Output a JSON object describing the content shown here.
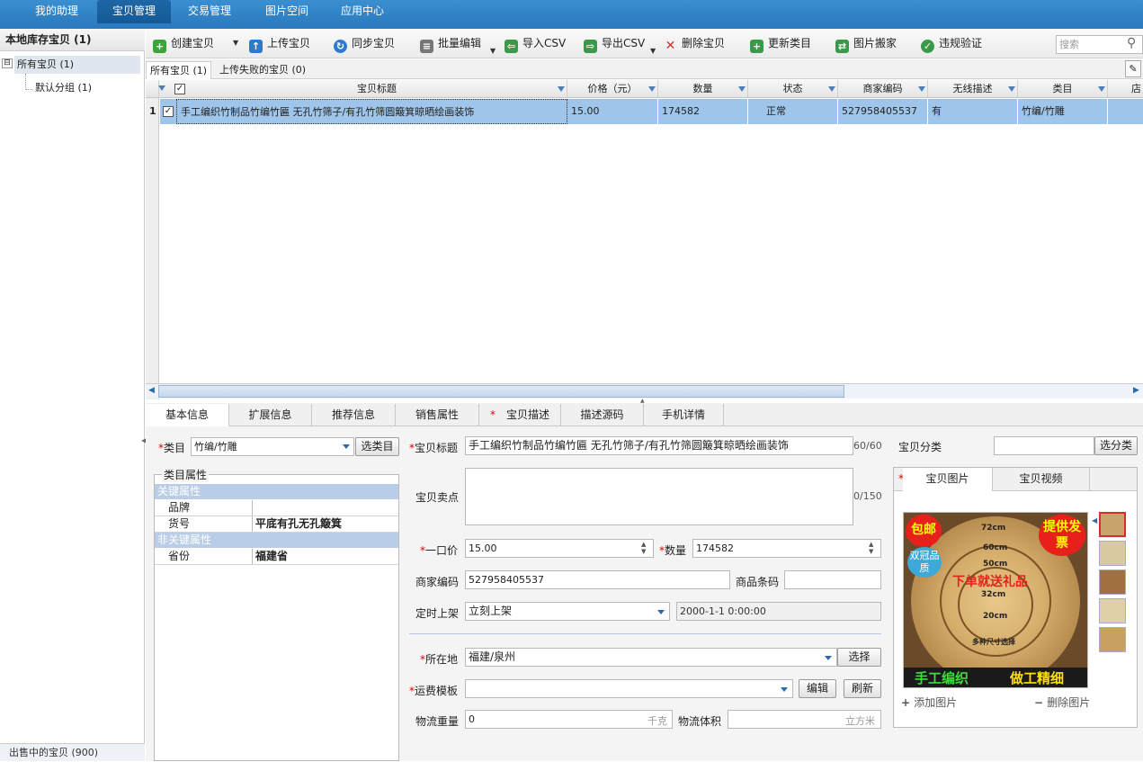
{
  "topnav": {
    "tabs": [
      "我的助理",
      "宝贝管理",
      "交易管理",
      "图片空间",
      "应用中心"
    ],
    "active_tab": "宝贝管理"
  },
  "sidebar": {
    "title": "本地库存宝贝 (1)",
    "tree": [
      {
        "label": "所有宝贝 (1)",
        "toggle": "⊟"
      },
      {
        "label": "默认分组 (1)"
      }
    ],
    "bottom_label": "出售中的宝贝 (900)"
  },
  "toolbar": {
    "buttons": [
      {
        "label": "创建宝贝",
        "icon": "plus-icon",
        "color": "#3aa63a"
      },
      {
        "label": "上传宝贝",
        "icon": "upload-icon",
        "color": "#2b7bd0"
      },
      {
        "label": "同步宝贝",
        "icon": "sync-icon",
        "color": "#2b7bd0"
      },
      {
        "label": "批量编辑",
        "icon": "batch-edit-icon",
        "color": "#555555"
      },
      {
        "label": "导入CSV",
        "icon": "import-csv-icon",
        "color": "#3a9a4a"
      },
      {
        "label": "导出CSV",
        "icon": "export-csv-icon",
        "color": "#3a9a4a"
      },
      {
        "label": "删除宝贝",
        "icon": "delete-icon",
        "color": "#d03030"
      },
      {
        "label": "更新类目",
        "icon": "update-category-icon",
        "color": "#3a9a4a"
      },
      {
        "label": "图片搬家",
        "icon": "image-move-icon",
        "color": "#3a9a4a"
      },
      {
        "label": "违规验证",
        "icon": "check-icon",
        "color": "#3a9a4a"
      }
    ],
    "search_placeholder": "搜索"
  },
  "subtabs": [
    "所有宝贝 (1)",
    "上传失败的宝贝 (0)"
  ],
  "grid": {
    "columns": [
      "宝贝标题",
      "价格（元）",
      "数量",
      "状态",
      "商家编码",
      "无线描述",
      "类目",
      "店铺"
    ],
    "rows": [
      {
        "num": "1",
        "title": "手工编织竹制品竹编竹匾 无孔竹筛子/有孔竹筛圆簸箕晾晒绘画装饰",
        "price": "15.00",
        "qty": "174582",
        "status": "正常",
        "code": "527958405537",
        "wireless": "有",
        "category": "竹编/竹雕",
        "shop": ""
      }
    ]
  },
  "detail_tabs": [
    "基本信息",
    "扩展信息",
    "推荐信息",
    "销售属性",
    "宝贝描述",
    "描述源码",
    "手机详情"
  ],
  "form": {
    "category_label": "类目",
    "category_value": "竹编/竹雕",
    "category_btn": "选类目",
    "attr_group_label": "类目属性",
    "key_attr_label": "关键属性",
    "key_attrs": [
      {
        "k": "品牌",
        "v": ""
      },
      {
        "k": "货号",
        "v": "平底有孔无孔簸箕"
      }
    ],
    "nonkey_attr_label": "非关键属性",
    "nonkey_attrs": [
      {
        "k": "省份",
        "v": "福建省"
      }
    ],
    "title_label": "宝贝标题",
    "title_value": "手工编织竹制品竹编竹匾 无孔竹筛子/有孔竹筛圆簸箕晾晒绘画装饰",
    "title_count": "60/60",
    "selling_label": "宝贝卖点",
    "selling_count": "0/150",
    "price_label": "一口价",
    "price_value": "15.00",
    "qty_label": "数量",
    "qty_value": "174582",
    "code_label": "商家编码",
    "code_value": "527958405537",
    "barcode_label": "商品条码",
    "timing_label": "定时上架",
    "timing_value": "立刻上架",
    "timing_date": "2000-1-1 0:00:00",
    "location_label": "所在地",
    "location_value": "福建/泉州",
    "location_btn": "选择",
    "freight_label": "运费模板",
    "freight_edit_btn": "编辑",
    "freight_refresh_btn": "刷新",
    "weight_label": "物流重量",
    "weight_value": "0",
    "weight_unit": "千克",
    "volume_label": "物流体积",
    "volume_unit": "立方米",
    "shop_cat_label": "宝贝分类",
    "shop_cat_btn": "选分类"
  },
  "image_panel": {
    "tabs": [
      "宝贝图片",
      "宝贝视频"
    ],
    "add_label": "添加图片",
    "remove_label": "删除图片",
    "img_text": {
      "badge_left": "包邮",
      "badge_left2": "双冠品质",
      "badge_right": "提供发票",
      "sizes": [
        "72cm",
        "60cm",
        "50cm",
        "32cm",
        "20cm"
      ],
      "promo": "下单就送礼品",
      "note": "多种尺寸选择",
      "bottom_left": "手工编织",
      "bottom_right": "做工精细"
    }
  },
  "colors": {
    "nav_blue": "#2a78bd",
    "row_selected": "#9fc6ea",
    "required": "#dd0000"
  }
}
